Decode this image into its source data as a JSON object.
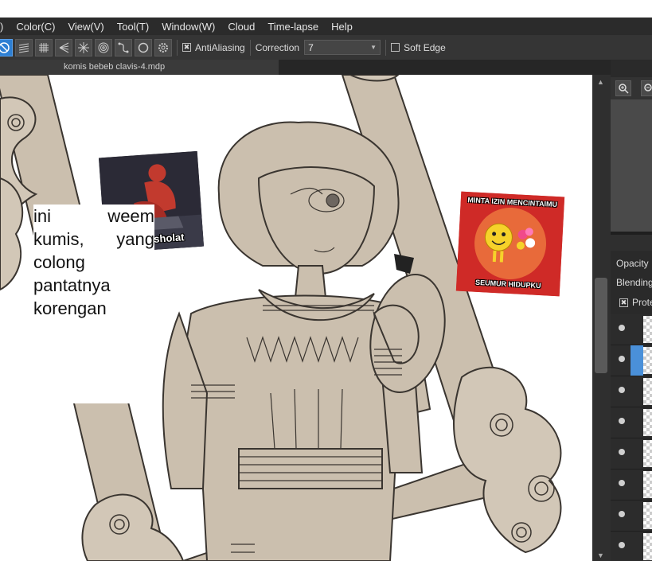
{
  "menubar": {
    "items": [
      "Color(C)",
      "View(V)",
      "Tool(T)",
      "Window(W)",
      "Cloud",
      "Time-lapse",
      "Help"
    ]
  },
  "toolbar": {
    "antialiasing_label": "AntiAliasing",
    "antialiasing_checked": true,
    "correction_label": "Correction",
    "correction_value": "7",
    "soft_edge_label": "Soft Edge",
    "soft_edge_checked": false,
    "active_color": "#2d7fd3"
  },
  "document": {
    "tab_title": "komis bebeb clavis-4.mdp"
  },
  "canvas": {
    "meme_left_caption": "reflek sholat",
    "meme_right_top": "MINTA IZIN MENCINTAIMU",
    "meme_right_bottom": "SEUMUR HIDUPKU",
    "note_lines": [
      "ini weem",
      "kumis, yang",
      "colong",
      "pantatnya",
      "korengan"
    ],
    "line_art_fill": "#cbbfae",
    "line_art_stroke": "#3a3530"
  },
  "right_panel": {
    "opacity_label": "Opacity",
    "blending_label": "Blending",
    "protect_label": "Prote",
    "protect_checked": true,
    "selected_layer_color": "#4a90d9"
  }
}
